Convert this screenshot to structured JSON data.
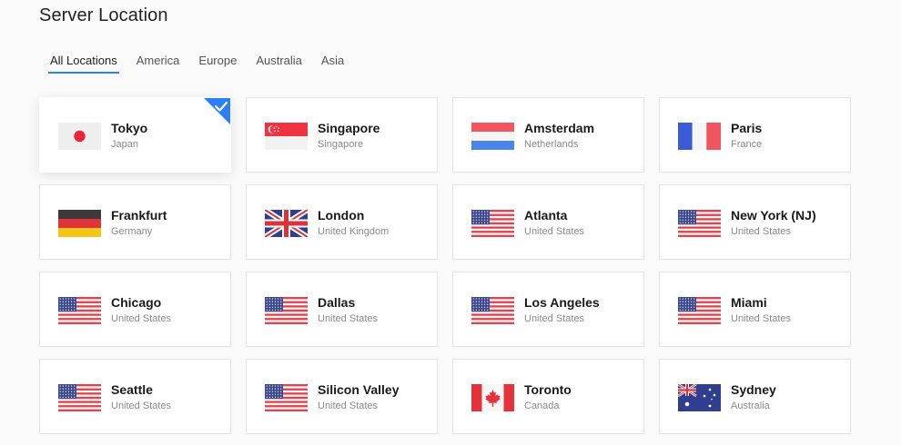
{
  "page": {
    "title": "Server Location"
  },
  "tabs": [
    {
      "label": "All Locations",
      "active": true
    },
    {
      "label": "America"
    },
    {
      "label": "Europe"
    },
    {
      "label": "Australia"
    },
    {
      "label": "Asia"
    }
  ],
  "colors": {
    "accent": "#2d7ff9"
  },
  "locations": [
    {
      "city": "Tokyo",
      "country": "Japan",
      "flag": "japan-flag-icon",
      "selected": true
    },
    {
      "city": "Singapore",
      "country": "Singapore",
      "flag": "singapore-flag-icon"
    },
    {
      "city": "Amsterdam",
      "country": "Netherlands",
      "flag": "netherlands-flag-icon"
    },
    {
      "city": "Paris",
      "country": "France",
      "flag": "france-flag-icon"
    },
    {
      "city": "Frankfurt",
      "country": "Germany",
      "flag": "germany-flag-icon"
    },
    {
      "city": "London",
      "country": "United Kingdom",
      "flag": "uk-flag-icon"
    },
    {
      "city": "Atlanta",
      "country": "United States",
      "flag": "usa-flag-icon"
    },
    {
      "city": "New York (NJ)",
      "country": "United States",
      "flag": "usa-flag-icon"
    },
    {
      "city": "Chicago",
      "country": "United States",
      "flag": "usa-flag-icon"
    },
    {
      "city": "Dallas",
      "country": "United States",
      "flag": "usa-flag-icon"
    },
    {
      "city": "Los Angeles",
      "country": "United States",
      "flag": "usa-flag-icon"
    },
    {
      "city": "Miami",
      "country": "United States",
      "flag": "usa-flag-icon"
    },
    {
      "city": "Seattle",
      "country": "United States",
      "flag": "usa-flag-icon"
    },
    {
      "city": "Silicon Valley",
      "country": "United States",
      "flag": "usa-flag-icon"
    },
    {
      "city": "Toronto",
      "country": "Canada",
      "flag": "canada-flag-icon"
    },
    {
      "city": "Sydney",
      "country": "Australia",
      "flag": "australia-flag-icon"
    }
  ]
}
